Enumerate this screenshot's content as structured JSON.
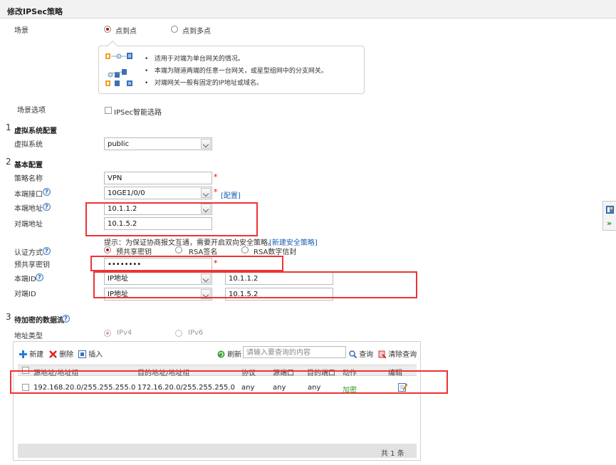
{
  "title": "修改IPSec策略",
  "scene": {
    "label": "场景",
    "options": [
      "点到点",
      "点到多点"
    ],
    "selected": 0,
    "bullets": [
      "适用于对端为单台网关的情况。",
      "本端为隧道两端的任意一台网关，或星型组网中的分支网关。",
      "对端网关一般有固定的IP地址或域名。"
    ]
  },
  "scene_options": {
    "label": "场景选项",
    "checkbox_label": "IPSec智能选路",
    "checked": false
  },
  "section1": {
    "num": "1",
    "title": "虚拟系统配置",
    "vsys_label": "虚拟系统",
    "vsys_value": "public"
  },
  "section2": {
    "num": "2",
    "title": "基本配置",
    "policy_name_label": "策略名称",
    "policy_name_value": "VPN",
    "local_if_label": "本端接口",
    "local_if_value": "10GE1/0/0",
    "config_link": "[配置]",
    "local_addr_label": "本端地址",
    "local_addr_value": "10.1.1.2",
    "peer_addr_label": "对端地址",
    "peer_addr_value": "10.1.5.2",
    "hint_text": "提示：为保证协商报文互通，需要开启双向安全策略。",
    "new_policy_link": "[新建安全策略]",
    "auth_label": "认证方式",
    "auth_options": [
      "预共享密钥",
      "RSA签名",
      "RSA数字信封"
    ],
    "auth_selected": 0,
    "psk_label": "预共享密钥",
    "psk_value": "••••••••",
    "local_id_label": "本端ID",
    "local_id_type": "IP地址",
    "local_id_value": "10.1.1.2",
    "peer_id_label": "对端ID",
    "peer_id_type": "IP地址",
    "peer_id_value": "10.1.5.2",
    "required_mark": "*"
  },
  "section3": {
    "num": "3",
    "title": "待加密的数据流",
    "addr_type_label": "地址类型",
    "addr_type_options": [
      "IPv4",
      "IPv6"
    ],
    "addr_type_selected": 0,
    "toolbar": {
      "new": "新建",
      "delete": "删除",
      "insert": "插入",
      "refresh": "刷新",
      "search_placeholder": "请输入要查询的内容",
      "query": "查询",
      "clear_query": "清除查询"
    },
    "columns": [
      "源地址/地址组",
      "目的地址/地址组",
      "协议",
      "源端口",
      "目的端口",
      "动作",
      "编辑"
    ],
    "rows": [
      {
        "src": "192.168.20.0/255.255.255.0",
        "dst": "172.16.20.0/255.255.255.0",
        "protocol": "any",
        "src_port": "any",
        "dst_port": "any",
        "action": "加密"
      }
    ],
    "footer": "共 1 条"
  },
  "colors": {
    "highlight_box": "#e33333",
    "link": "#1a5fb4",
    "action_green": "#2e9a2e",
    "required": "#e00000"
  }
}
